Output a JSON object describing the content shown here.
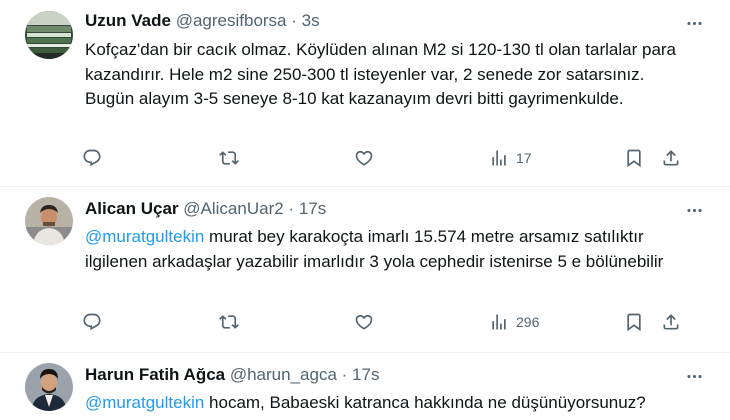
{
  "tweets": [
    {
      "name": "Uzun Vade",
      "handle": "@agresifborsa",
      "time": "3s",
      "text": "Kofçaz'dan bir cacık olmaz. Köylüden alınan M2 si 120-130 tl olan tarlalar para kazandırır. Hele m2 sine 250-300 tl isteyenler var, 2 senede zor satarsınız. Bugün alayım 3-5 seneye 8-10 kat kazanayım devri bitti gayrimenkulde.",
      "views": "17"
    },
    {
      "name": "Alican Uçar",
      "handle": "@AlicanUar2",
      "time": "17s",
      "mention": "@muratgultekin",
      "text": " murat bey karakoçta imarlı 15.574 metre arsamız satılıktır ilgilenen arkadaşlar yazabilir imarlıdır 3 yola cephedir istenirse 5 e bölünebilir",
      "views": "296"
    },
    {
      "name": "Harun Fatih Ağca",
      "handle": "@harun_agca",
      "time": "17s",
      "mention": "@muratgultekin",
      "text": " hocam, Babaeski katranca hakkında ne düşünüyorsunuz?"
    }
  ],
  "separator": "·",
  "icons": {
    "reply": "reply-icon",
    "retweet": "retweet-icon",
    "like": "heart-icon",
    "views": "views-icon",
    "bookmark": "bookmark-icon",
    "share": "share-icon",
    "more": "more-icon"
  },
  "colors": {
    "link": "#1d9bf0",
    "muted": "#536471",
    "text": "#0f1419"
  }
}
